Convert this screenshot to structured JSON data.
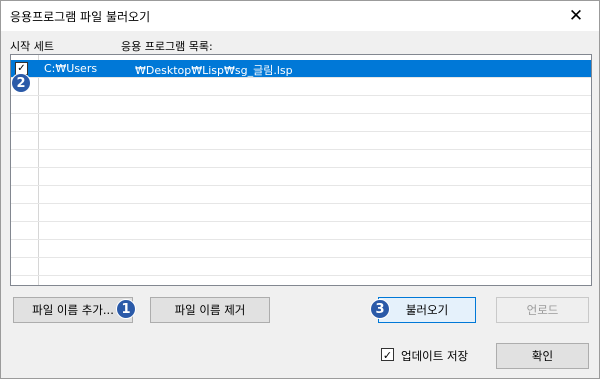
{
  "window": {
    "title": "응용프로그램 파일 불러오기",
    "close_glyph": "✕"
  },
  "columns": {
    "start_set": "시작 세트",
    "app_list": "응용 프로그램 목록:"
  },
  "rows": [
    {
      "checked_glyph": "✓",
      "path_left": "C:₩Users",
      "path_right": "₩Desktop₩Lisp₩sg_글림.lsp"
    }
  ],
  "buttons": {
    "add_file": "파일 이름 추가...",
    "remove_file": "파일 이름 제거",
    "load": "불러오기",
    "unload": "언로드",
    "ok": "확인"
  },
  "update_save": {
    "label": "업데이트 저장",
    "checked_glyph": "✓"
  },
  "badges": {
    "one": "1",
    "two": "2",
    "three": "3"
  },
  "colors": {
    "selection": "#0078d7",
    "badge": "#2b5aa8"
  }
}
